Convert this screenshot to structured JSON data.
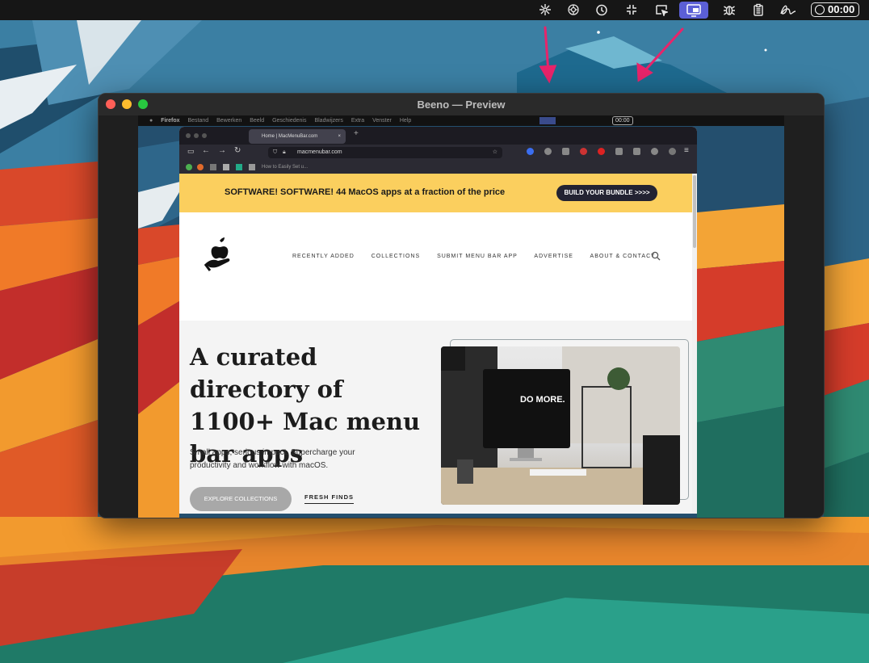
{
  "menubar": {
    "icons": [
      "pinwheel-icon",
      "openai-icon",
      "clock-history-icon",
      "compress-icon",
      "cursor-window-icon",
      "beeno-screen-icon",
      "bug-icon",
      "clipboard-icon",
      "signature-icon"
    ],
    "timer": "00:00"
  },
  "window": {
    "title": "Beeno — Preview"
  },
  "inner_menubar": {
    "items": [
      "Firefox",
      "Bestand",
      "Bewerken",
      "Beeld",
      "Geschiedenis",
      "Bladwijzers",
      "Extra",
      "Venster",
      "Help"
    ],
    "timer": "00:00"
  },
  "firefox": {
    "tab_title": "Home | MacMenuBar.com",
    "url": "macmenubar.com",
    "bookmark": "How to Easily Set u..."
  },
  "banner": {
    "text": "SOFTWARE! SOFTWARE! 44 MacOS apps at a fraction of the price",
    "button": "BUILD YOUR BUNDLE >>>>"
  },
  "nav": {
    "items": [
      "RECENTLY ADDED",
      "COLLECTIONS",
      "SUBMIT MENU BAR APP",
      "ADVERTISE",
      "ABOUT & CONTACT"
    ]
  },
  "hero": {
    "title": "A curated directory of 1100+ Mac menu bar apps",
    "subtitle": "Small apps, serious impact. Supercharge your productivity and workflow with macOS.",
    "primary_button": "EXPLORE COLLECTIONS",
    "secondary_link": "FRESH FINDS",
    "image_text": "DO MORE."
  },
  "colors": {
    "accent_purple": "#5b5fd6",
    "arrow_pink": "#e8246a",
    "banner_yellow": "#fbcf5e"
  }
}
